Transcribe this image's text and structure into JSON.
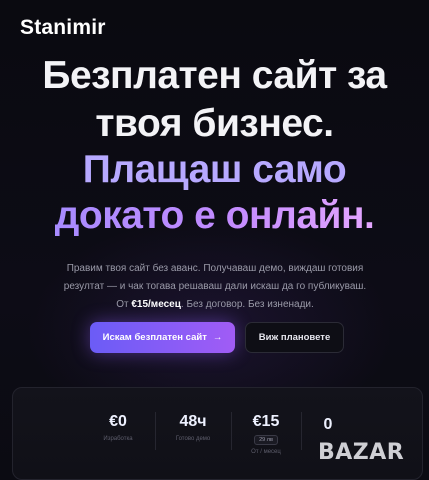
{
  "brand": {
    "name": "Stanimir"
  },
  "hero": {
    "line1": "Безплатен сайт за",
    "line2": "твоя бизнес.",
    "line3": "Плащаш само",
    "line4": "докато е онлайн.",
    "description_part1": "Правим твоя сайт без аванс. Получаваш демо, виждаш готовия резултат — и чак тогава решаваш дали искаш да го публикуваш. От ",
    "description_price": "€15/месец",
    "description_part2": ". Без договор. Без изненади."
  },
  "actions": {
    "primary_label": "Искам безплатен сайт",
    "primary_arrow": "→",
    "secondary_label": "Виж плановете"
  },
  "stats": [
    {
      "value": "€0",
      "label": "Изработка"
    },
    {
      "value": "48ч",
      "label": "Готово демо"
    },
    {
      "value": "€15",
      "badge": "29 лв",
      "label": "От / месец"
    },
    {
      "value": "0",
      "label": ""
    }
  ],
  "watermark": {
    "text": "BAZAR"
  },
  "colors": {
    "accent": "#8b5cf6",
    "accent_light": "#b7a9ff",
    "background": "#0b0b12"
  }
}
